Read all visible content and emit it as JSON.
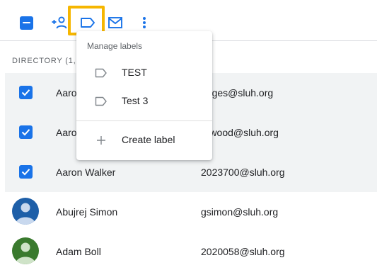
{
  "toolbar": {
    "icons": [
      "select-all-checkbox",
      "add-person-icon",
      "label-icon",
      "email-icon",
      "more-vert-icon"
    ]
  },
  "directory": {
    "header": "DIRECTORY (1,6"
  },
  "rows": [
    {
      "name": "Aaro",
      "email": "odges@sluh.org",
      "selected": true
    },
    {
      "name": "Aaro",
      "email": "erwood@sluh.org",
      "selected": true
    },
    {
      "name": "Aaron Walker",
      "email": "2023700@sluh.org",
      "selected": true
    },
    {
      "name": "Abujrej Simon",
      "email": "gsimon@sluh.org",
      "selected": false,
      "avatar_color": "#1e5fa8"
    },
    {
      "name": "Adam Boll",
      "email": "2020058@sluh.org",
      "selected": false,
      "avatar_color": "#3a7a2e"
    }
  ],
  "menu": {
    "title": "Manage labels",
    "labels": [
      "TEST",
      "Test 3"
    ],
    "create": "Create label"
  },
  "colors": {
    "accent": "#1a73e8",
    "highlight": "#f6b600",
    "selected_row": "#f1f3f4"
  }
}
